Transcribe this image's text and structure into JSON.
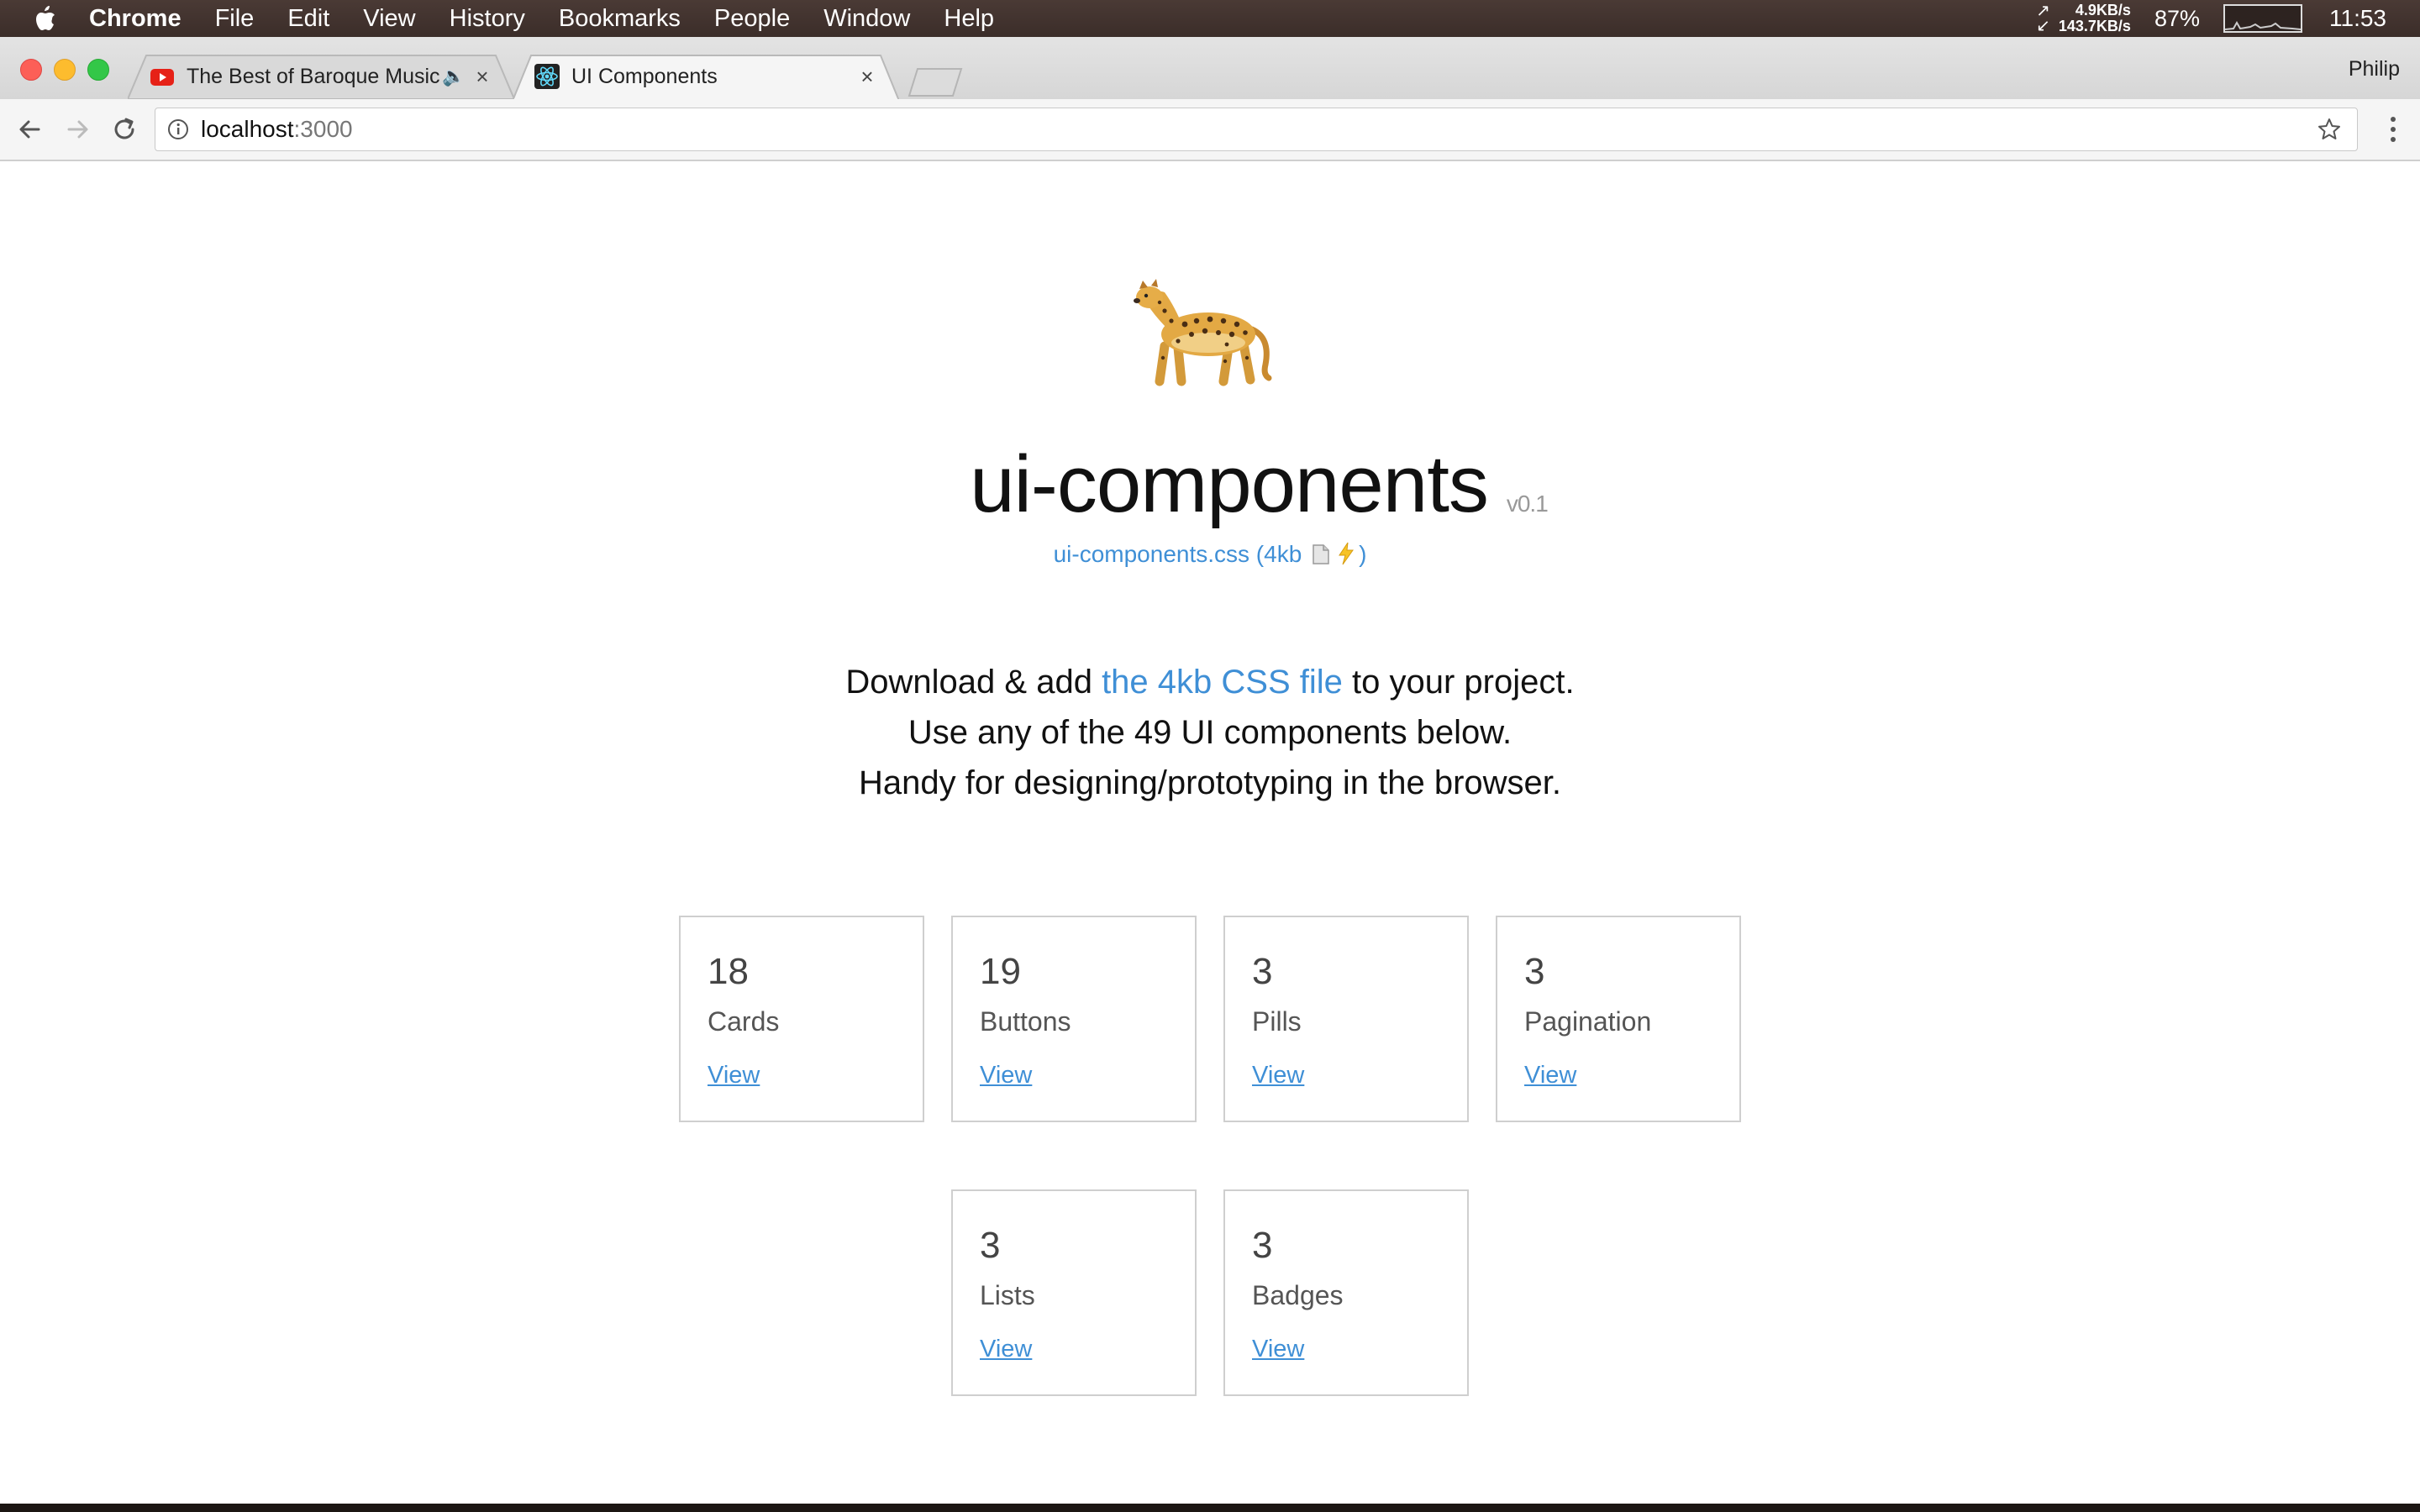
{
  "menubar": {
    "app": "Chrome",
    "items": [
      "File",
      "Edit",
      "View",
      "History",
      "Bookmarks",
      "People",
      "Window",
      "Help"
    ],
    "net_up": "4.9KB/s",
    "net_down": "143.7KB/s",
    "battery": "87%",
    "clock": "11:53"
  },
  "browser": {
    "tabs": [
      {
        "title": "The Best of Baroque Music",
        "favicon": "youtube-icon"
      },
      {
        "title": "UI Components",
        "favicon": "react-icon"
      }
    ],
    "profile": "Philip",
    "url_host": "localhost",
    "url_port": ":3000"
  },
  "page": {
    "title": "ui-components",
    "version": "v0.1",
    "css_link_prefix": "ui-components.css (4kb",
    "css_link_suffix": ")",
    "intro": {
      "line1_before": "Download & add ",
      "line1_link": "the 4kb CSS file",
      "line1_after": " to your project.",
      "line2": "Use any of the 49 UI components below.",
      "line3": "Handy for designing/prototyping in the browser."
    },
    "cards": [
      {
        "count": "18",
        "label": "Cards",
        "link": "View"
      },
      {
        "count": "19",
        "label": "Buttons",
        "link": "View"
      },
      {
        "count": "3",
        "label": "Pills",
        "link": "View"
      },
      {
        "count": "3",
        "label": "Pagination",
        "link": "View"
      },
      {
        "count": "3",
        "label": "Lists",
        "link": "View"
      },
      {
        "count": "3",
        "label": "Badges",
        "link": "View"
      }
    ]
  },
  "colors": {
    "link": "#3f8fd6",
    "card_border": "#cfcfcf"
  }
}
